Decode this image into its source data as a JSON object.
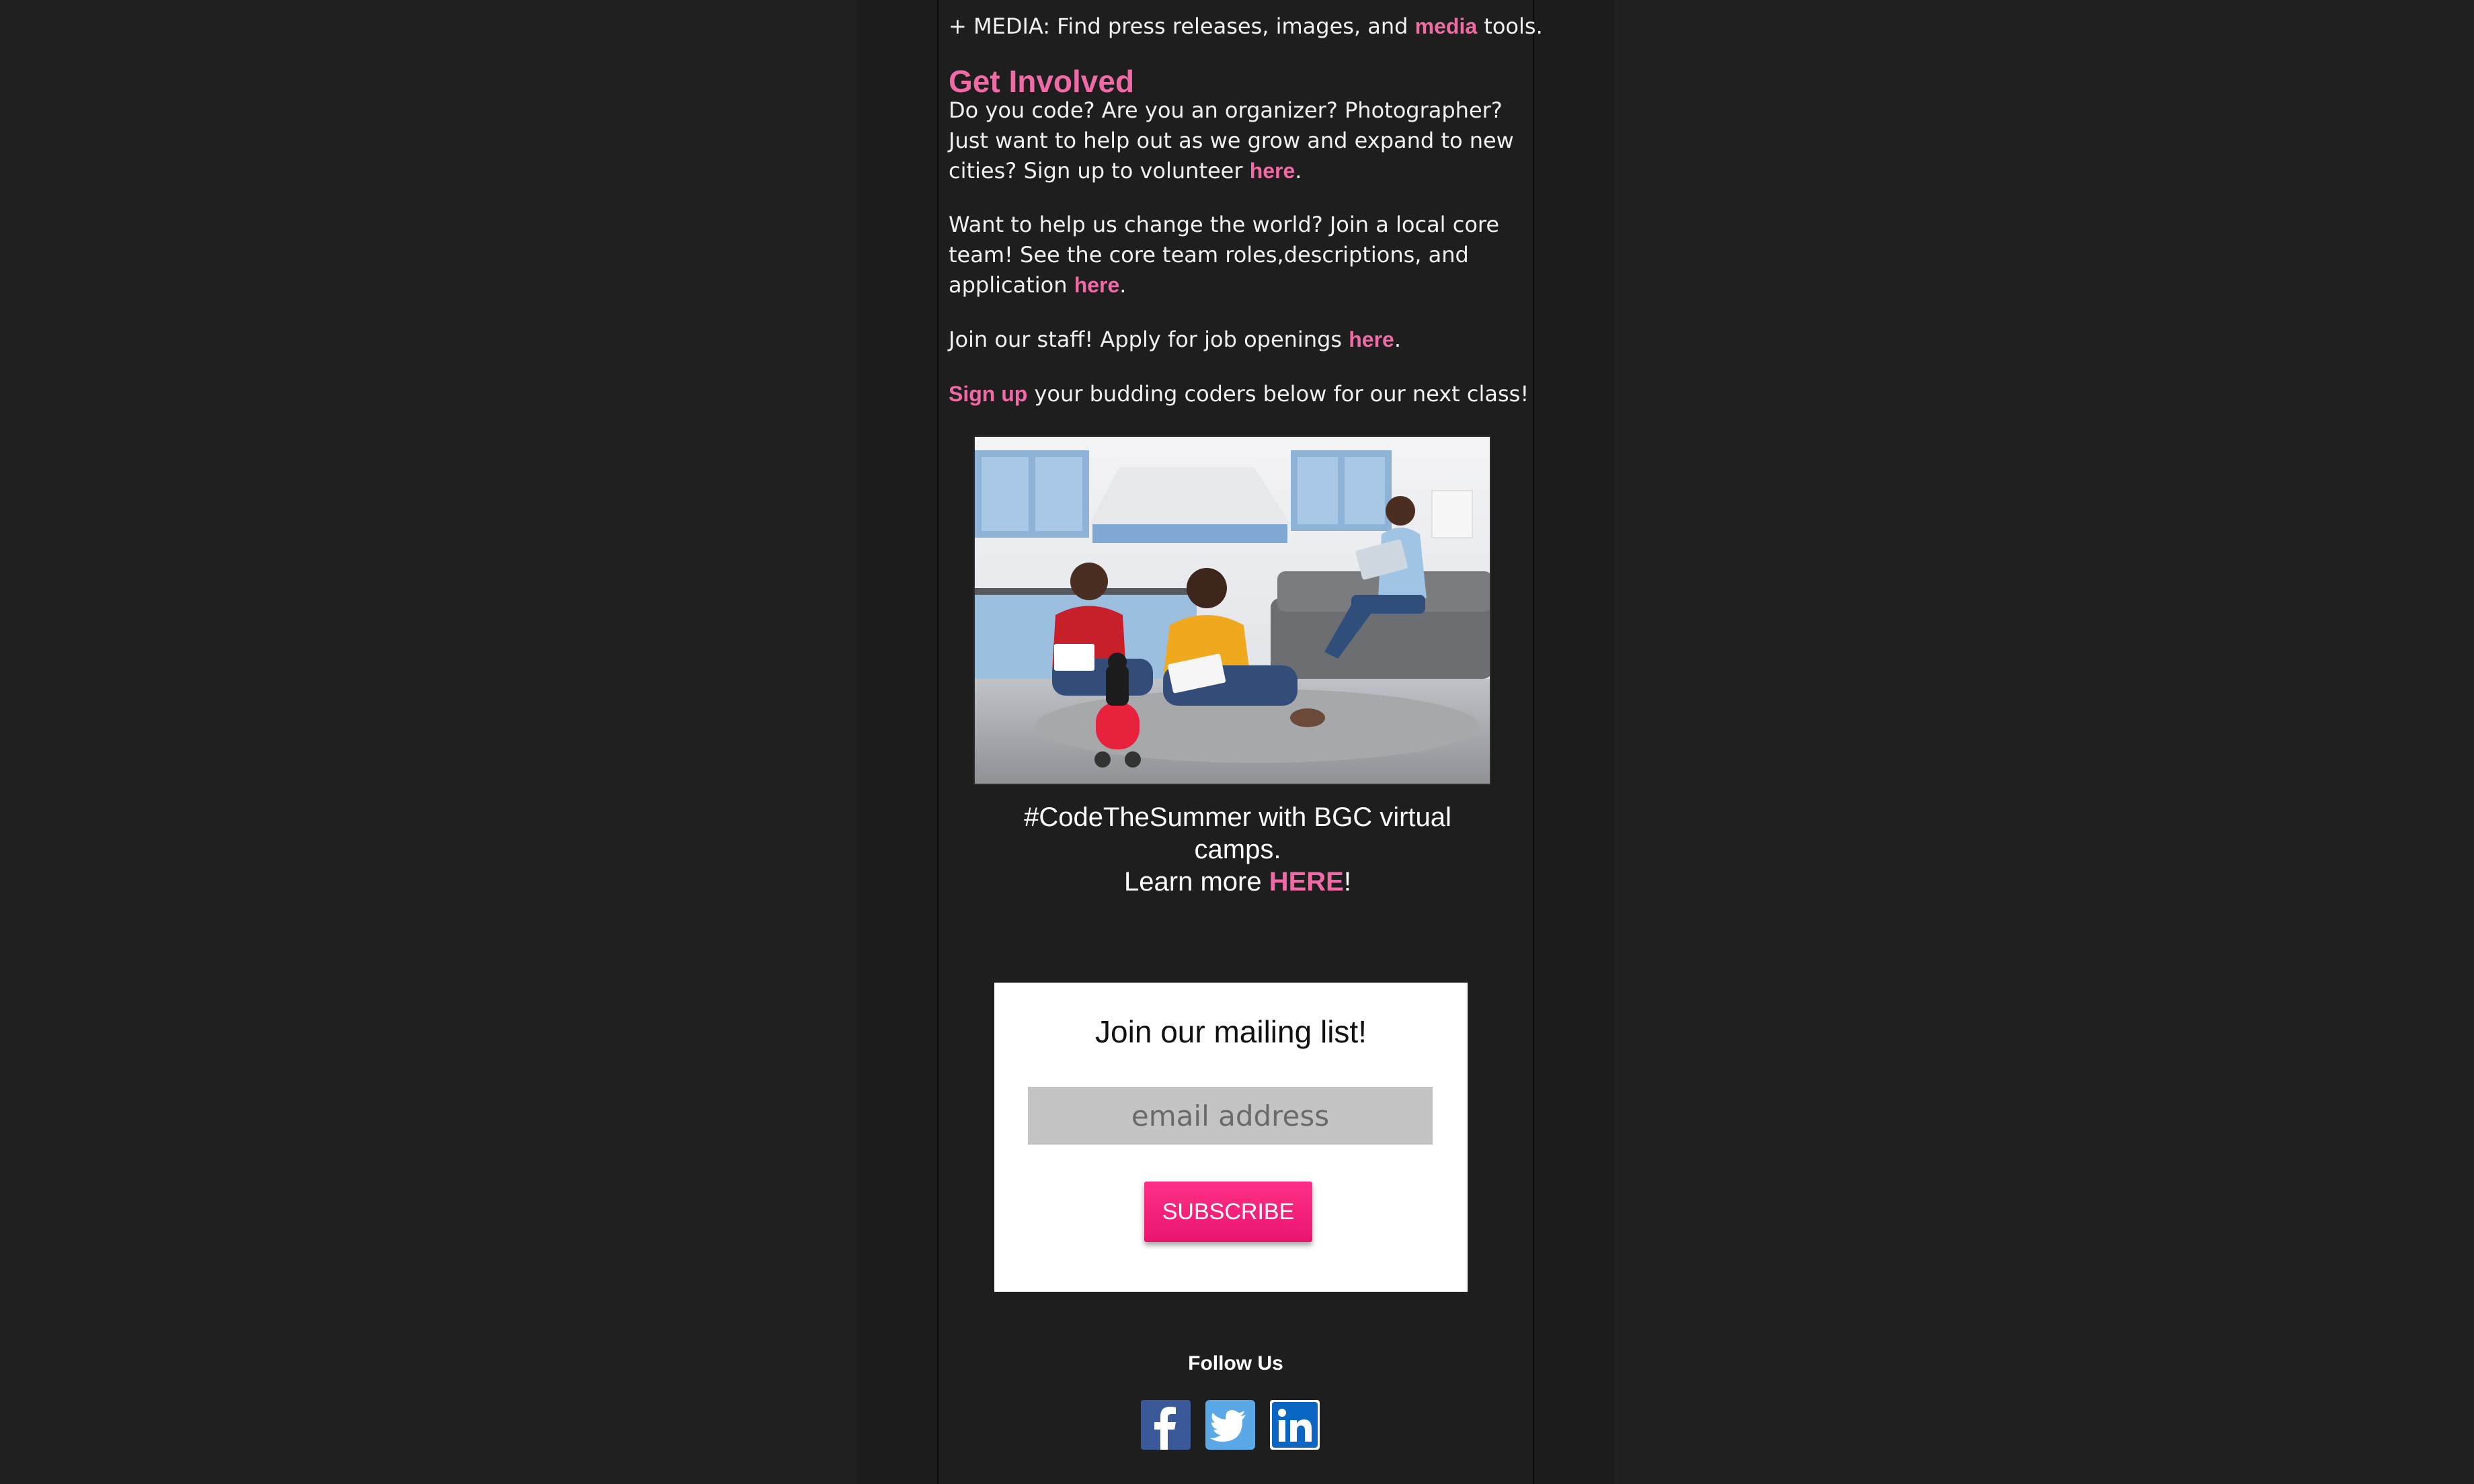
{
  "intro": {
    "media_prefix": "+ MEDIA: Find press releases, images, and ",
    "media_link": "media",
    "media_suffix": " tools."
  },
  "get_involved": {
    "heading": "Get Involved",
    "volunteer_text": "Do you code? Are you an organizer? Photographer? Just want to help out as we grow and expand to new cities? Sign up to volunteer ",
    "volunteer_link": "here",
    "core_team_text": "Want to help us change the world? Join a local core team! See the core team roles,descriptions, and application ",
    "core_team_link": "here",
    "staff_text": "Join our staff! Apply for job openings ",
    "staff_link": "here",
    "signup_link": "Sign up",
    "signup_text": " your budding coders below for our next class!",
    "period": "."
  },
  "promo": {
    "caption_line1": "#CodeTheSummer with BGC virtual camps.",
    "caption_prefix": "Learn more ",
    "caption_link": "HERE",
    "caption_suffix": "!"
  },
  "mailing_list": {
    "title": "Join our mailing list!",
    "placeholder": "email address",
    "value": "",
    "button_label": "SUBSCRIBE"
  },
  "footer": {
    "follow_title": "Follow Us",
    "social": [
      {
        "icon": "facebook-icon",
        "glyph": "f",
        "color": "#3b5998"
      },
      {
        "icon": "twitter-icon",
        "color": "#1da1f2"
      },
      {
        "icon": "linkedin-icon",
        "glyph": "in",
        "color": "#0a66c2"
      }
    ]
  },
  "colors": {
    "accent_pink": "#f06aa5",
    "button_pink": "#ff2f87",
    "page_bg": "#202020",
    "column_bg": "#1e1e1e"
  }
}
